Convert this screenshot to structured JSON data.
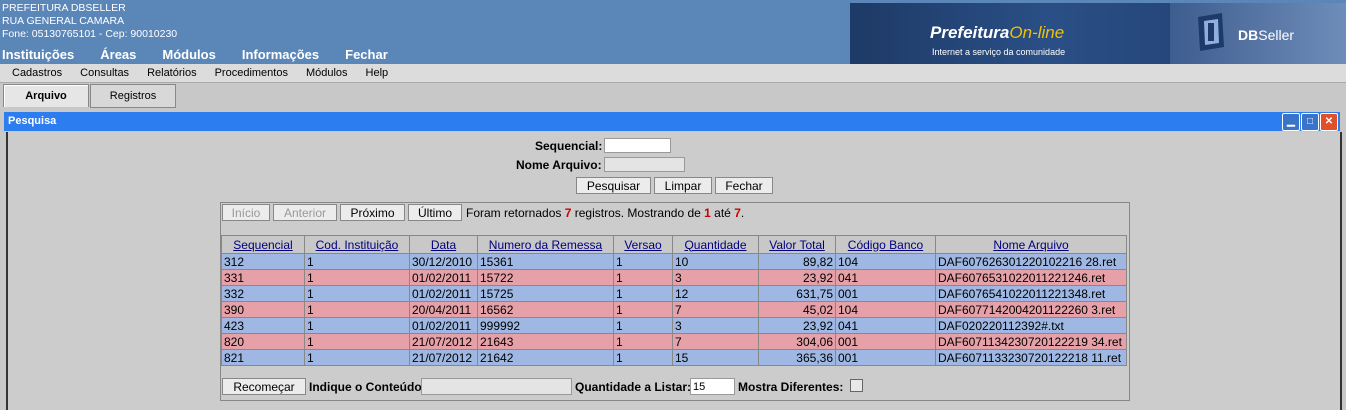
{
  "header": {
    "info_lines": [
      "PREFEITURA DBSELLER",
      "RUA GENERAL CAMARA",
      "Fone: 05130765101  -  Cep: 90010230"
    ],
    "main_menu": [
      "Instituições",
      "Áreas",
      "Módulos",
      "Informações",
      "Fechar"
    ],
    "brand_prefeitura": "Prefeitura",
    "brand_online": "On-line",
    "brand_tagline": "Internet a serviço da comunidade",
    "brand_db_bold": "DB",
    "brand_db_rest": "Seller"
  },
  "sub_menu": [
    "Cadastros",
    "Consultas",
    "Relatórios",
    "Procedimentos",
    "Módulos",
    "Help"
  ],
  "tabs": [
    "Arquivo",
    "Registros"
  ],
  "window": {
    "title": "Pesquisa",
    "min_glyph": "▁",
    "max_glyph": "□",
    "close_glyph": "✕"
  },
  "form": {
    "sequencial_label": "Sequencial:",
    "sequencial_value": "",
    "nome_arquivo_label": "Nome Arquivo:",
    "nome_arquivo_value": "",
    "pesquisar": "Pesquisar",
    "limpar": "Limpar",
    "fechar": "Fechar"
  },
  "pager": {
    "inicio": "Início",
    "anterior": "Anterior",
    "proximo": "Próximo",
    "ultimo": "Último",
    "text_1": "Foram retornados ",
    "total": "7",
    "text_2": " registros. Mostrando de ",
    "from": "1",
    "text_3": " até ",
    "to": "7",
    "text_4": "."
  },
  "table": {
    "headers": [
      "Sequencial",
      "Cod. Instituição",
      "Data",
      "Numero da Remessa",
      "Versao",
      "Quantidade",
      "Valor Total",
      "Código Banco",
      "Nome Arquivo"
    ],
    "rows": [
      {
        "color": "blue",
        "cells": [
          "312",
          "1",
          "30/12/2010",
          "15361",
          "1",
          "10",
          "89,82",
          "104",
          "DAF607626301220102216 28.ret"
        ]
      },
      {
        "color": "pink",
        "cells": [
          "331",
          "1",
          "01/02/2011",
          "15722",
          "1",
          "3",
          "23,92",
          "041",
          "DAF6076531022011221246.ret"
        ]
      },
      {
        "color": "blue",
        "cells": [
          "332",
          "1",
          "01/02/2011",
          "15725",
          "1",
          "12",
          "631,75",
          "001",
          "DAF6076541022011221348.ret"
        ]
      },
      {
        "color": "pink",
        "cells": [
          "390",
          "1",
          "20/04/2011",
          "16562",
          "1",
          "7",
          "45,02",
          "104",
          "DAF6077142004201122260 3.ret"
        ]
      },
      {
        "color": "blue",
        "cells": [
          "423",
          "1",
          "01/02/2011",
          "999992",
          "1",
          "3",
          "23,92",
          "041",
          "DAF020220112392#.txt"
        ]
      },
      {
        "color": "pink",
        "cells": [
          "820",
          "1",
          "21/07/2012",
          "21643",
          "1",
          "7",
          "304,06",
          "001",
          "DAF6071134230720122219 34.ret"
        ]
      },
      {
        "color": "blue",
        "cells": [
          "821",
          "1",
          "21/07/2012",
          "21642",
          "1",
          "15",
          "365,36",
          "001",
          "DAF6071133230720122218 11.ret"
        ]
      }
    ]
  },
  "footer": {
    "recomecar": "Recomeçar",
    "indique_label": "Indique o Conteúdo:",
    "indique_value": "",
    "quantidade_label": "Quantidade a Listar:",
    "quantidade_value": "15",
    "mostra_label": "Mostra Diferentes:"
  },
  "colors": {
    "header_bg": "#5b86b8",
    "title_bar": "#2b7df0",
    "row_blue": "#9eb7e3",
    "row_pink": "#e6a0a8",
    "highlight_red": "#cc0000"
  }
}
